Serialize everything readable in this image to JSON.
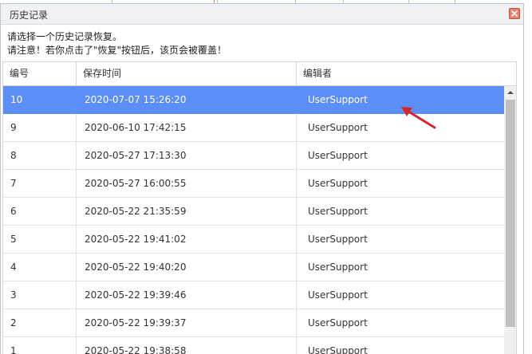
{
  "dialog": {
    "title": "历史记录",
    "instruction_line1": "请选择一个历史记录恢复。",
    "instruction_line2": "请注意！若你点击了\"恢复\"按钮后，该页会被覆盖！"
  },
  "table": {
    "headers": [
      "编号",
      "保存时间",
      "编辑者"
    ],
    "rows": [
      {
        "id": "10",
        "time": "2020-07-07 15:26:20",
        "editor": "UserSupport",
        "selected": true
      },
      {
        "id": "9",
        "time": "2020-06-10 17:42:15",
        "editor": "UserSupport"
      },
      {
        "id": "8",
        "time": "2020-05-27 17:13:30",
        "editor": "UserSupport"
      },
      {
        "id": "7",
        "time": "2020-05-27 16:00:55",
        "editor": "UserSupport"
      },
      {
        "id": "6",
        "time": "2020-05-22 21:35:59",
        "editor": "UserSupport"
      },
      {
        "id": "5",
        "time": "2020-05-22 19:41:02",
        "editor": "UserSupport"
      },
      {
        "id": "4",
        "time": "2020-05-22 19:40:20",
        "editor": "UserSupport"
      },
      {
        "id": "3",
        "time": "2020-05-22 19:39:46",
        "editor": "UserSupport"
      },
      {
        "id": "2",
        "time": "2020-05-22 19:39:37",
        "editor": "UserSupport"
      },
      {
        "id": "1",
        "time": "2020-05-22 19:38:58",
        "editor": "UserSupport"
      }
    ]
  },
  "icons": {
    "close": "close-icon",
    "scroll_up": "chevron-up-icon",
    "annotation": "red-arrow-icon"
  },
  "colors": {
    "selected_row": "#5b8ef6",
    "close_button": "#e8826b",
    "annotation_arrow": "#d9262b"
  }
}
